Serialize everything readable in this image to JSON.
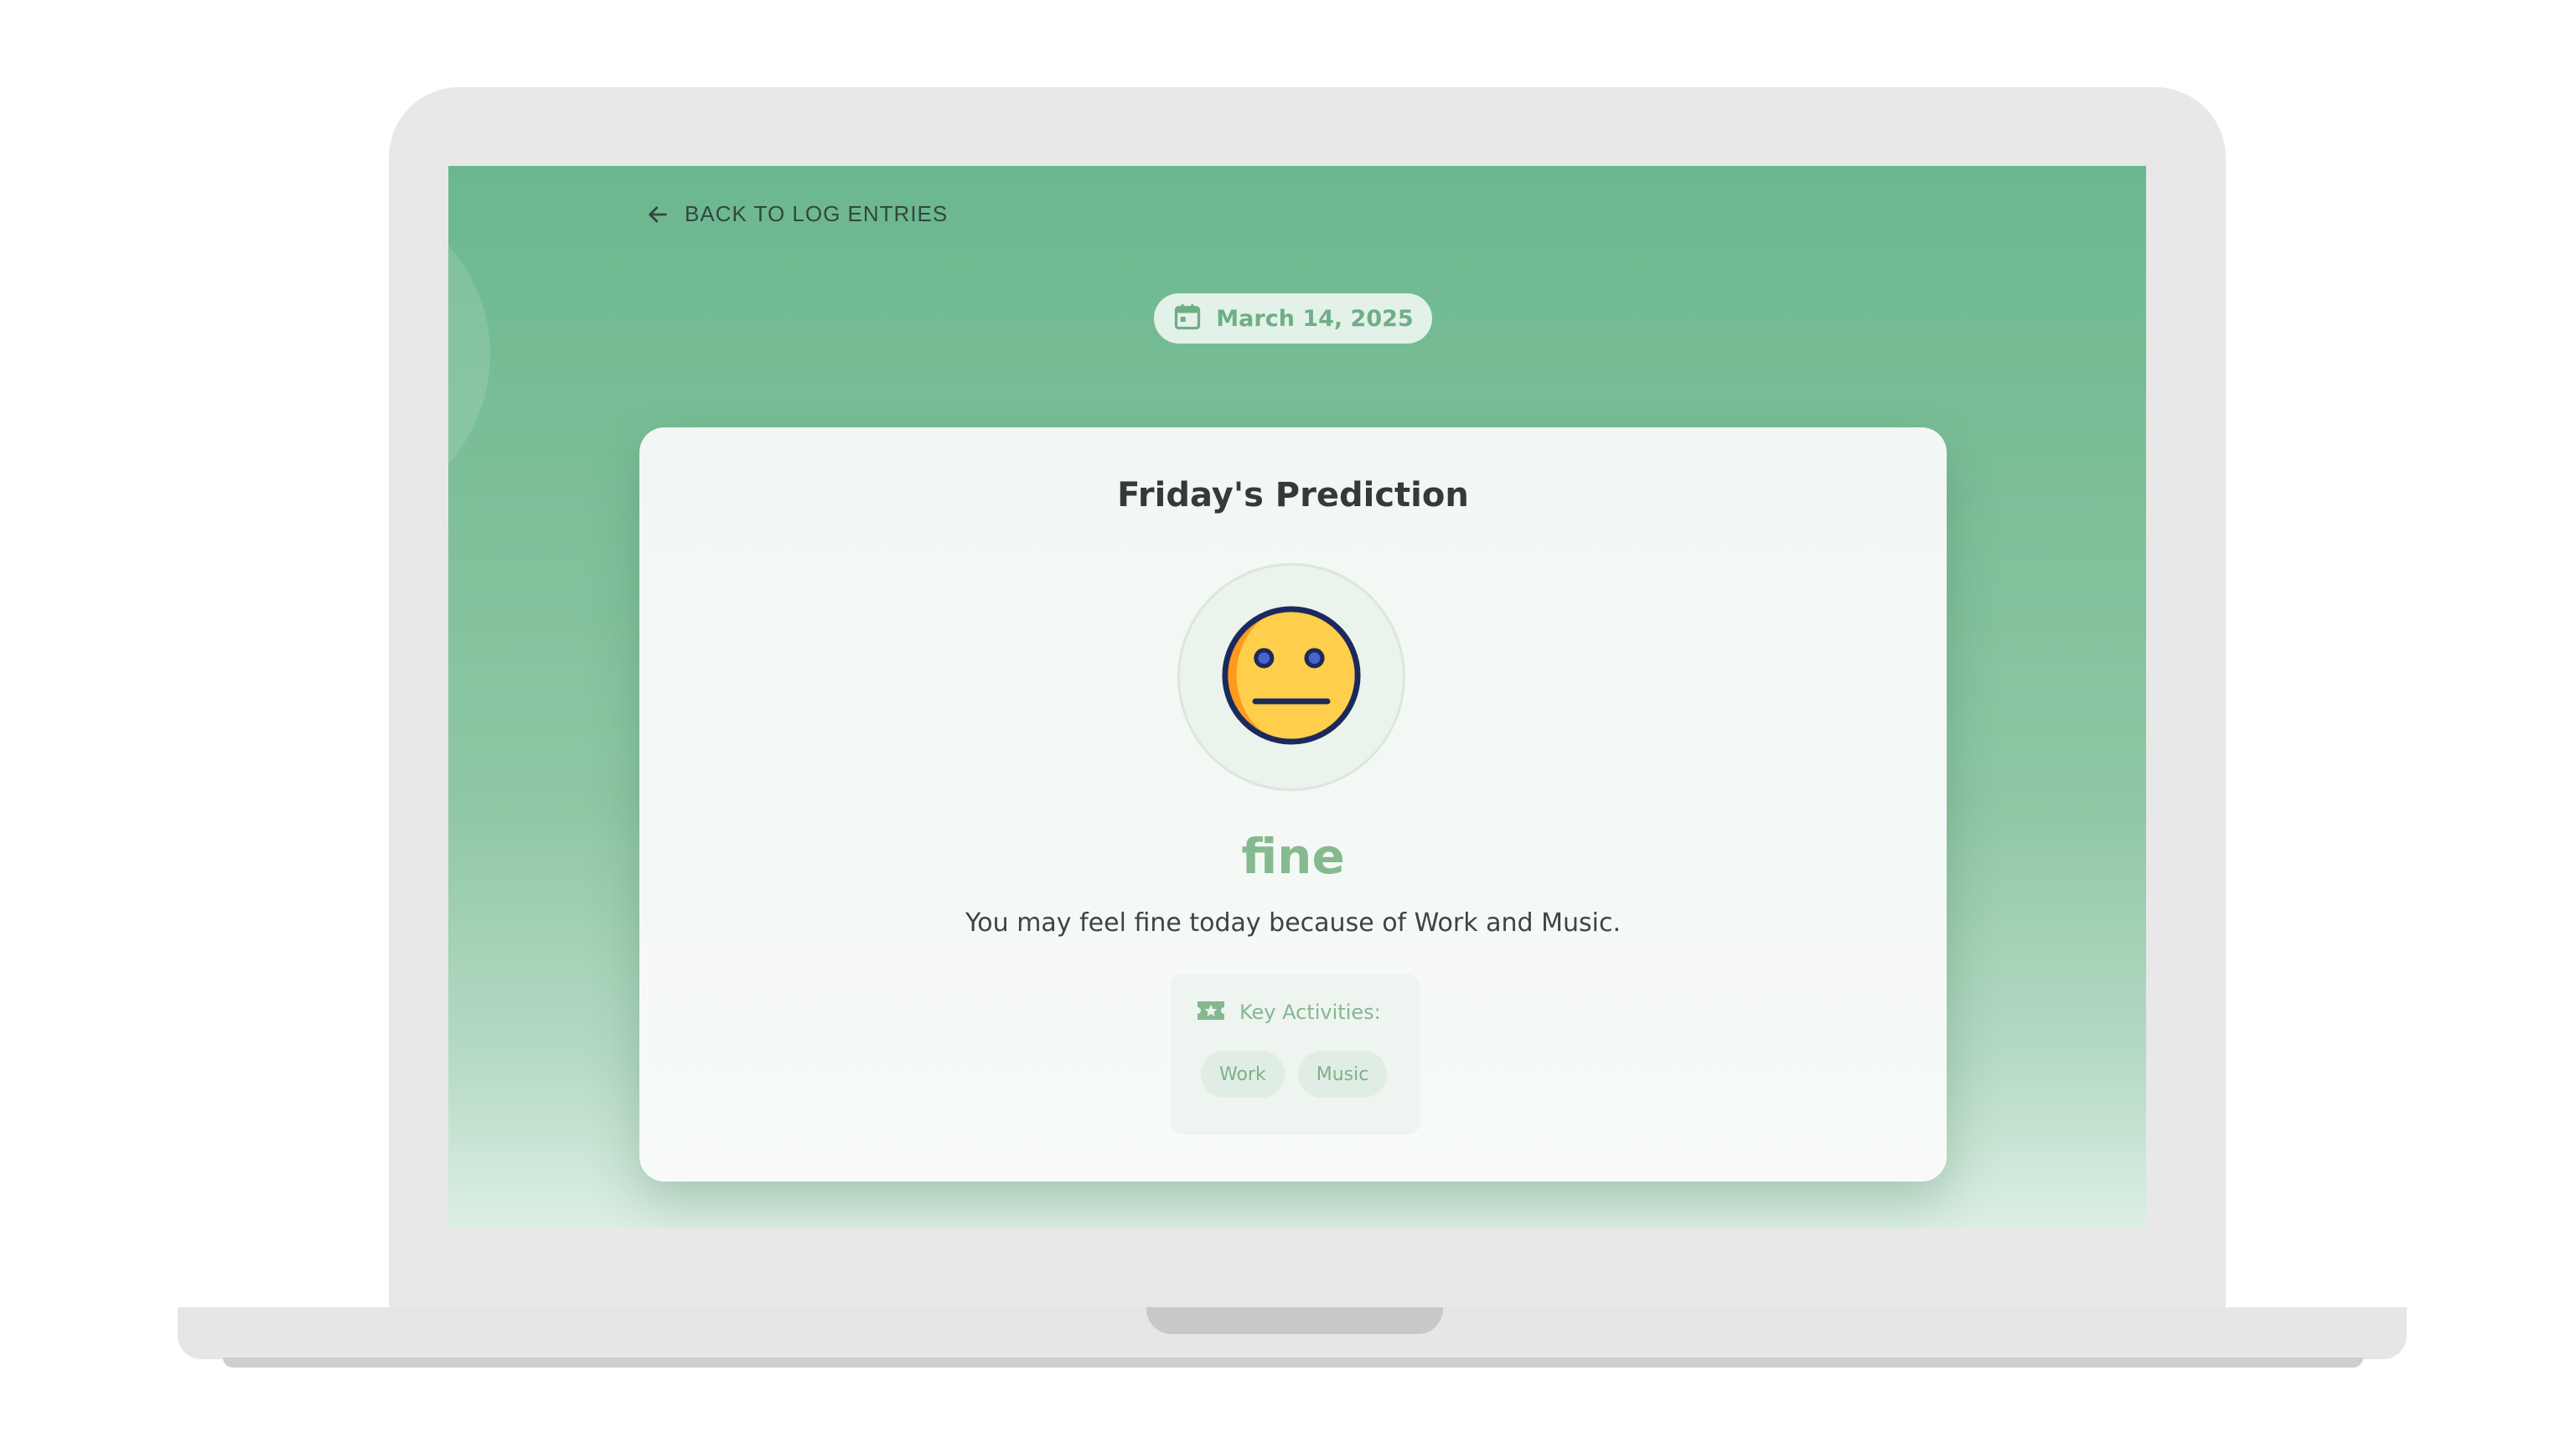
{
  "nav": {
    "back_label": "BACK TO LOG ENTRIES",
    "back_icon": "arrow-left-icon"
  },
  "date_badge": {
    "icon": "calendar-icon",
    "text": "March 14, 2025"
  },
  "prediction": {
    "title": "Friday's Prediction",
    "emoji_icon": "neutral-face-icon",
    "mood": "fine",
    "description": "You may feel fine today because of Work and Music.",
    "activities": {
      "icon": "ticket-star-icon",
      "label": "Key Activities:",
      "items": [
        "Work",
        "Music"
      ]
    }
  },
  "colors": {
    "accent_green": "#6bb78f",
    "mood_green": "#86b98f",
    "emoji_yellow": "#ffce4a",
    "emoji_orange": "#ff9a1f",
    "emoji_outline": "#1b2a5c"
  }
}
